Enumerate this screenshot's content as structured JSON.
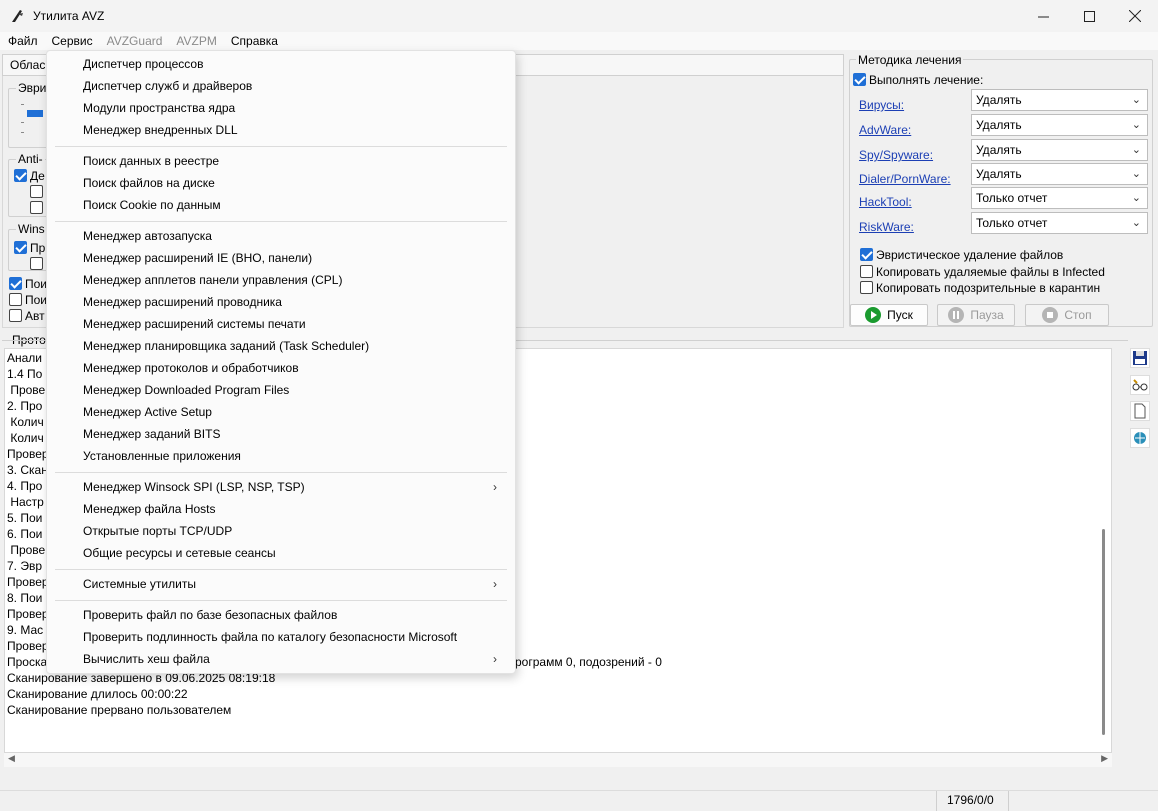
{
  "window": {
    "title": "Утилита AVZ"
  },
  "menubar": [
    "Файл",
    "Сервис",
    "AVZGuard",
    "AVZPM",
    "Справка"
  ],
  "left": {
    "area_label": "Облас",
    "heur_label": "Эври",
    "anti_label": "Anti-",
    "anti_item1": "Де",
    "wins_label": "Wins",
    "wins_item1": "Пр",
    "opt1": "Пои",
    "opt2": "Пои",
    "opt3": "Авт",
    "protocol_label": "Прото"
  },
  "treatment": {
    "title": "Методика лечения",
    "perform": "Выполнять лечение:",
    "rows": [
      {
        "label": "Вирусы:",
        "value": "Удалять"
      },
      {
        "label": "AdvWare:",
        "value": "Удалять"
      },
      {
        "label": "Spy/Spyware:",
        "value": "Удалять"
      },
      {
        "label": "Dialer/PornWare:",
        "value": "Удалять"
      },
      {
        "label": "HackTool:",
        "value": "Только отчет"
      },
      {
        "label": "RiskWare:",
        "value": "Только отчет"
      }
    ],
    "heuristic_delete": "Эвристическое удаление файлов",
    "copy_deleted": "Копировать удаляемые файлы в  Infected",
    "copy_suspicious": "Копировать подозрительные в  карантин"
  },
  "buttons": {
    "start": "Пуск",
    "pause": "Пауза",
    "stop": "Стоп"
  },
  "log_lines": [
    "Анали",
    "1.4 По",
    " Прове",
    "2. Про",
    " Колич",
    " Колич",
    "Провер",
    "3. Скан",
    "4. Про",
    " Настр",
    "5. Пои",
    "6. Пои",
    " Прове",
    "7. Эвр",
    "Провер",
    "8. Пои",
    "Провер",
    "9. Мас",
    "Провер",
    "Проска",
    "Сканирование завершено в 09.06.2025 08:19:18",
    "Сканирование длилось 00:00:22",
    "Сканирование прервано пользователем"
  ],
  "log_tail_fragment": "рограмм 0, подозрений - 0",
  "status": {
    "counter": "1796/0/0"
  },
  "service_menu": {
    "items": [
      "Диспетчер процессов",
      "Диспетчер служб и драйверов",
      "Модули пространства ядра",
      "Менеджер внедренных DLL",
      "Поиск данных  в реестре",
      "Поиск файлов на диске",
      "Поиск Cookie по данным",
      "Менеджер автозапуска",
      "Менеджер расширений IE (BHO, панели)",
      "Менеджер апплетов панели управления (CPL)",
      "Менеджер расширений проводника",
      "Менеджер расширений системы печати",
      "Менеджер планировщика заданий (Task Scheduler)",
      "Менеджер протоколов и обработчиков",
      "Менеджер Downloaded Program Files",
      "Менеджер Active Setup",
      "Менеджер заданий BITS",
      "Установленные приложения",
      "Менеджер Winsock SPI (LSP, NSP, TSP)",
      "Менеджер файла Hosts",
      "Открытые порты TCP/UDP",
      "Общие ресурсы и сетевые сеансы",
      "Системные утилиты",
      "Проверить файл по базе безопасных файлов",
      "Проверить подлинность файла по каталогу безопасности Microsoft",
      "Вычислить хеш файла"
    ]
  },
  "colors": {
    "accent": "#1f6fd6",
    "link": "#1c3fb4",
    "start_green": "#1a9b2f"
  }
}
